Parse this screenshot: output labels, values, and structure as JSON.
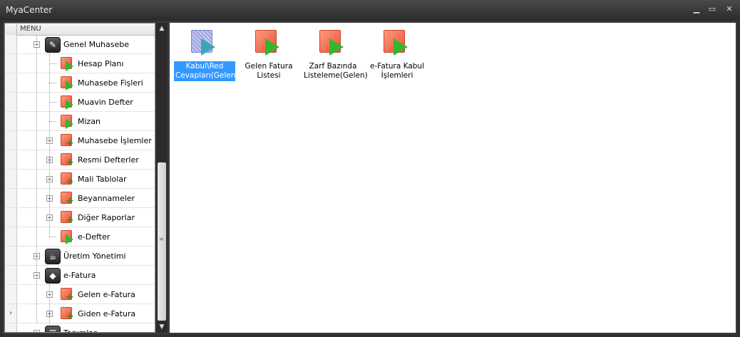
{
  "window": {
    "title": "MyaCenter",
    "minimize_glyph": "▁",
    "maximize_glyph": "▭",
    "close_glyph": "✕"
  },
  "tree": {
    "header": "MENU",
    "current_row_marker": "›",
    "items": [
      {
        "label": "Genel Muhasebe",
        "icon": "pen-doc-icon",
        "expander": "-"
      },
      {
        "label": "Hesap Planı",
        "icon": "run-report-icon"
      },
      {
        "label": "Muhasebe Fişleri",
        "icon": "run-report-icon"
      },
      {
        "label": "Muavin Defter",
        "icon": "run-report-icon"
      },
      {
        "label": "Mizan",
        "icon": "run-report-icon"
      },
      {
        "label": "Muhasebe İşlemler",
        "icon": "folder-add-icon",
        "expander": "+"
      },
      {
        "label": "Resmi Defterler",
        "icon": "folder-add-icon",
        "expander": "+"
      },
      {
        "label": "Mali Tablolar",
        "icon": "folder-add-icon",
        "expander": "+"
      },
      {
        "label": "Beyannameler",
        "icon": "folder-add-icon",
        "expander": "+"
      },
      {
        "label": "Diğer Raporlar",
        "icon": "folder-add-icon",
        "expander": "+"
      },
      {
        "label": "e-Defter",
        "icon": "run-report-icon"
      },
      {
        "label": "Üretim Yönetimi",
        "icon": "coffee-cup-icon",
        "expander": "+"
      },
      {
        "label": "e-Fatura",
        "icon": "e-invoice-icon",
        "expander": "-"
      },
      {
        "label": "Gelen e-Fatura",
        "icon": "folder-add-icon",
        "expander": "+"
      },
      {
        "label": "Giden  e-Fatura",
        "icon": "folder-add-icon",
        "expander": "+"
      },
      {
        "label": "Tanımlar",
        "icon": "list-icon",
        "expander": "+"
      }
    ]
  },
  "main": {
    "tiles": [
      {
        "label": "Kabul\\Red Cevapları(Gelen)",
        "icon": "inbox-response-icon",
        "selected": true
      },
      {
        "label": "Gelen Fatura Listesi",
        "icon": "run-report-icon",
        "selected": false
      },
      {
        "label": "Zarf Bazında Listeleme(Gelen)",
        "icon": "run-report-icon",
        "selected": false
      },
      {
        "label": "e-Fatura Kabul İşlemleri",
        "icon": "run-report-icon",
        "selected": false
      }
    ]
  },
  "colors": {
    "selection": "#3399ff",
    "play_green": "#35b530",
    "doc_red": "#e9503a"
  }
}
